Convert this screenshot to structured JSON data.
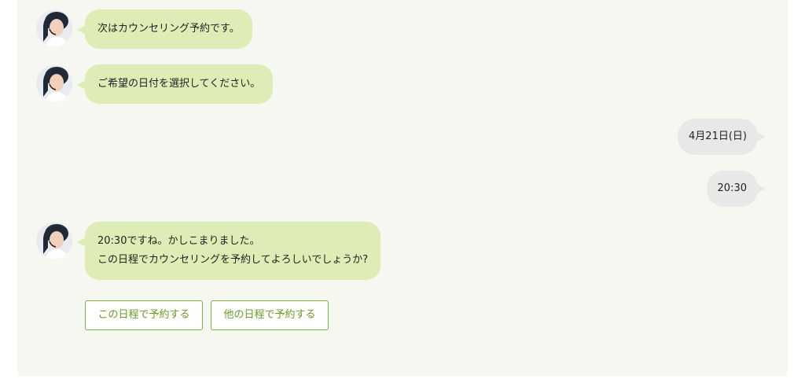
{
  "messages": [
    {
      "sender": "bot",
      "lines": [
        "次はカウンセリング予約です。"
      ],
      "avatar_icon": "operator-avatar-icon"
    },
    {
      "sender": "bot",
      "lines": [
        "ご希望の日付を選択してください。"
      ],
      "avatar_icon": "operator-avatar-icon"
    },
    {
      "sender": "user",
      "text": "4月21日(日)"
    },
    {
      "sender": "user",
      "text": "20:30"
    },
    {
      "sender": "bot",
      "lines": [
        "20:30ですね。かしこまりました。",
        "この日程でカウンセリングを予約してよろしいでしょうか?"
      ],
      "avatar_icon": "operator-avatar-icon"
    }
  ],
  "actions": {
    "confirm_label": "この日程で予約する",
    "other_date_label": "他の日程で予約する"
  },
  "colors": {
    "panel_background": "#f7f7f2",
    "bot_bubble": "#deedb6",
    "user_bubble": "#e8e8e8",
    "button_border": "#7cb342",
    "button_text": "#6a9a2a"
  }
}
